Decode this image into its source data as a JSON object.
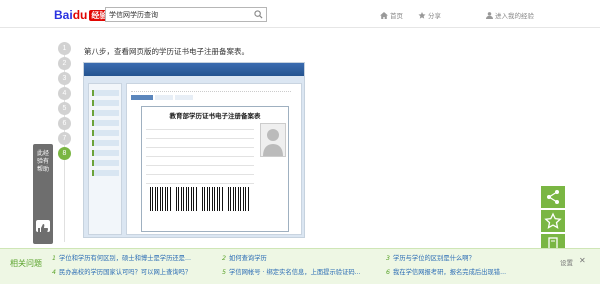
{
  "header": {
    "logo_bai": "Bai",
    "logo_du": "du",
    "logo_sub": "经验",
    "search_value": "学信网学历查询",
    "nav": [
      {
        "label": "首页",
        "icon": "home-icon"
      },
      {
        "label": "分享",
        "icon": "star-icon"
      },
      {
        "label": "进入我的经验",
        "icon": "user-icon"
      }
    ]
  },
  "steps": [
    "1",
    "2",
    "3",
    "4",
    "5",
    "6",
    "7",
    "8"
  ],
  "active_step": "8",
  "step_text": "第八步，查看网页版的学历证书电子注册备案表。",
  "shot": {
    "cert_title": "教育部学历证书电子注册备案表"
  },
  "left_vote": {
    "label": "此经验有帮助"
  },
  "related": {
    "header": "相关问题",
    "items": [
      {
        "num": "1",
        "text": "学位和学历有何区别，硕士和博士是学历还是..."
      },
      {
        "num": "2",
        "text": "如何查询学历"
      },
      {
        "num": "3",
        "text": "学历与学位的区别是什么啊？"
      },
      {
        "num": "4",
        "text": "民办高校的学历国家认可吗？可以网上查询吗？"
      },
      {
        "num": "5",
        "text": "学信网帐号 · 绑定实名信息，上面提示验证码..."
      },
      {
        "num": "6",
        "text": "我在学信网报考研，报名完成后出现错..."
      }
    ],
    "settings_label": "设置",
    "close_label": "✕"
  },
  "colors": {
    "accent": "#7ab643",
    "link": "#2b6cb5"
  }
}
